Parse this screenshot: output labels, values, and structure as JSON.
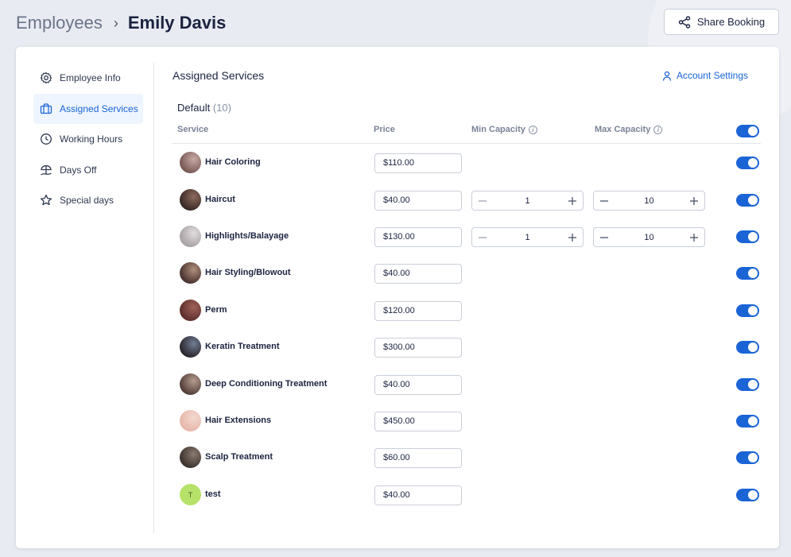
{
  "breadcrumb": {
    "root": "Employees",
    "separator": "›",
    "current": "Emily Davis"
  },
  "share_button": {
    "label": "Share Booking"
  },
  "sidebar": {
    "items": [
      {
        "label": "Employee Info",
        "icon": "gear-icon",
        "active": false
      },
      {
        "label": "Assigned Services",
        "icon": "briefcase-icon",
        "active": true
      },
      {
        "label": "Working Hours",
        "icon": "clock-icon",
        "active": false
      },
      {
        "label": "Days Off",
        "icon": "beach-umbrella-icon",
        "active": false
      },
      {
        "label": "Special days",
        "icon": "star-icon",
        "active": false
      }
    ]
  },
  "main": {
    "title": "Assigned Services",
    "account_settings": "Account Settings",
    "group": {
      "name": "Default",
      "count": "(10)"
    },
    "columns": {
      "service": "Service",
      "price": "Price",
      "min_capacity": "Min Capacity",
      "max_capacity": "Max Capacity"
    },
    "header_toggle_on": true,
    "services": [
      {
        "name": "Hair Coloring",
        "price": "$110.00",
        "min": null,
        "max": null,
        "enabled": true
      },
      {
        "name": "Haircut",
        "price": "$40.00",
        "min": "1",
        "max": "10",
        "enabled": true
      },
      {
        "name": "Highlights/Balayage",
        "price": "$130.00",
        "min": "1",
        "max": "10",
        "enabled": true
      },
      {
        "name": "Hair Styling/Blowout",
        "price": "$40.00",
        "min": null,
        "max": null,
        "enabled": true
      },
      {
        "name": "Perm",
        "price": "$120.00",
        "min": null,
        "max": null,
        "enabled": true
      },
      {
        "name": "Keratin Treatment",
        "price": "$300.00",
        "min": null,
        "max": null,
        "enabled": true
      },
      {
        "name": "Deep Conditioning Treatment",
        "price": "$40.00",
        "min": null,
        "max": null,
        "enabled": true
      },
      {
        "name": "Hair Extensions",
        "price": "$450.00",
        "min": null,
        "max": null,
        "enabled": true
      },
      {
        "name": "Scalp Treatment",
        "price": "$60.00",
        "min": null,
        "max": null,
        "enabled": true
      },
      {
        "name": "test",
        "price": "$40.00",
        "min": null,
        "max": null,
        "enabled": true,
        "avatar_letter": "T"
      }
    ]
  },
  "colors": {
    "accent": "#1a64d6",
    "background": "#e8ebf1",
    "card": "#ffffff",
    "avatar_letter_bg": "#b7e26a"
  }
}
